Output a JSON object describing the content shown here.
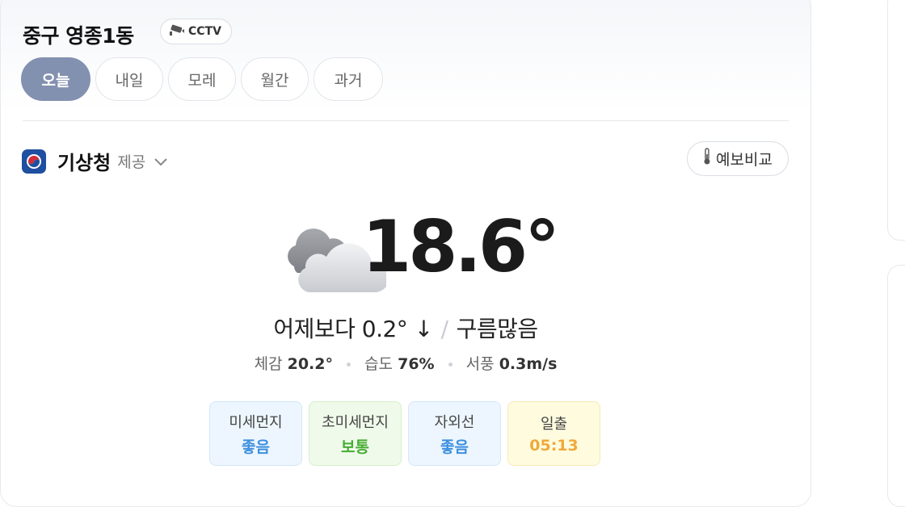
{
  "location": {
    "name": "중구 영종1동",
    "cctv_label": "CCTV"
  },
  "tabs": [
    {
      "label": "오늘",
      "active": true
    },
    {
      "label": "내일",
      "active": false
    },
    {
      "label": "모레",
      "active": false
    },
    {
      "label": "월간",
      "active": false
    },
    {
      "label": "과거",
      "active": false
    }
  ],
  "provider": {
    "name": "기상청",
    "suffix": "제공",
    "icon": "kma-logo-icon"
  },
  "compare_button": {
    "label": "예보비교",
    "icon": "thermometer-icon"
  },
  "current": {
    "icon": "cloudy-night-icon",
    "temperature": "18.6°",
    "compare_text": "어제보다 0.2° ↓",
    "condition": "구름많음",
    "feels_like_label": "체감",
    "feels_like": "20.2°",
    "humidity_label": "습도",
    "humidity": "76%",
    "wind_label": "서풍",
    "wind": "0.3m/s"
  },
  "indicators": [
    {
      "label": "미세먼지",
      "value": "좋음",
      "color": "#3d8fe0"
    },
    {
      "label": "초미세먼지",
      "value": "보통",
      "color": "#45ad33"
    },
    {
      "label": "자외선",
      "value": "좋음",
      "color": "#3d8fe0"
    },
    {
      "label": "일출",
      "value": "05:13",
      "color": "#f0a93a"
    }
  ],
  "colors": {
    "active_tab": "#8391b0",
    "provider_logo": "#1e4fa0"
  }
}
